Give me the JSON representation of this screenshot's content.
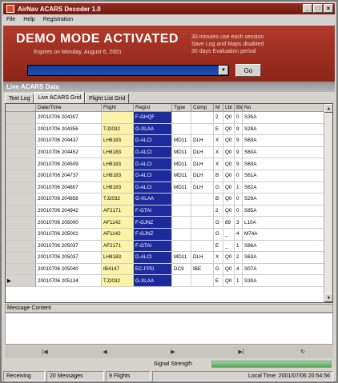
{
  "window": {
    "title": "AirNav ACARS Decoder 1.0",
    "buttons": [
      "_",
      "□",
      "×"
    ]
  },
  "menu": [
    "File",
    "Help",
    "Registration"
  ],
  "demo": {
    "title": "DEMO MODE ACTIVATED",
    "expires": "Expires on Monday, August 6, 2001",
    "notes": [
      "30 minutes use each session",
      "Save Log and Maps disabled",
      "30 days Evaluation period"
    ],
    "go_label": "Go"
  },
  "live": {
    "title": "Live ACARS Data",
    "tabs": [
      "Text Log",
      "Live ACARS Grid",
      "Flight List Grid"
    ],
    "active_tab": 1
  },
  "grid": {
    "columns": [
      "Date/Time",
      "Flight",
      "Regist",
      "Type",
      "Comp",
      "M",
      "Lbl",
      "Blc",
      "No"
    ],
    "rows": [
      [
        "20010706 204307",
        "",
        "F-GHQF",
        "",
        "",
        "2",
        "Q0",
        "0",
        "S35A"
      ],
      [
        "20010706 204356",
        "TJ2032",
        "G-XLAA",
        "",
        "",
        "E",
        "Q0",
        "9",
        "S28A"
      ],
      [
        "20010706 204437",
        "LH8183",
        "D-ALCI",
        "MD11",
        "DLH",
        "X",
        "Q0",
        "9",
        "S60A"
      ],
      [
        "20010706 204452",
        "LH8183",
        "D-ALCI",
        "MD11",
        "DLH",
        "X",
        "Q0",
        "9",
        "S60A"
      ],
      [
        "20010706 204509",
        "LH8183",
        "D-ALCI",
        "MD11",
        "DLH",
        "X",
        "Q0",
        "9",
        "S60A"
      ],
      [
        "20010706 204737",
        "LH8183",
        "D-ALCI",
        "MD11",
        "DLH",
        "B",
        "Q0",
        "0",
        "S61A"
      ],
      [
        "20010706 204807",
        "LH8183",
        "D-ALCI",
        "MD11",
        "DLH",
        "G",
        "Q0",
        "1",
        "S62A"
      ],
      [
        "20010706 204858",
        "TJ2032",
        "G-XLAA",
        "",
        "",
        "B",
        "Q0",
        "0",
        "S29A"
      ],
      [
        "20010706 204942",
        "AF2171",
        "F-GTAI",
        "",
        "",
        "2",
        "Q0",
        "0",
        "S85A"
      ],
      [
        "20010706 205000",
        "AF1142",
        "F-GJNZ",
        "",
        "",
        "G",
        "89",
        "3",
        "L10A"
      ],
      [
        "20010706 205001",
        "AF1142",
        "F-GJNZ",
        "",
        "",
        "G",
        "_",
        "4",
        "M74A"
      ],
      [
        "20010706 205037",
        "AF2171",
        "F-GTAI",
        "",
        "",
        "E",
        "_",
        "1",
        "S86A"
      ],
      [
        "20010706 205037",
        "LH8183",
        "D-ALCI",
        "MD11",
        "DLH",
        "X",
        "Q0",
        "2",
        "S63A"
      ],
      [
        "20010706 205040",
        "IB4147",
        "EC-FPD",
        "DC9",
        "IBE",
        "G",
        "Q0",
        "4",
        "S07A"
      ],
      [
        "20010706 205134",
        "TJ2032",
        "G-XLAA",
        "",
        "",
        "E",
        "Q0",
        "1",
        "S30A"
      ]
    ],
    "selected_row": 14
  },
  "message": {
    "title": "Message Content"
  },
  "nav": {
    "first": "|◀",
    "prev": "◀",
    "next": "▶",
    "last": "▶|",
    "refresh": "↻"
  },
  "signal": {
    "label": "Signal Strength",
    "level": 1.0
  },
  "status": {
    "state": "Receiving",
    "messages": "20 Messages",
    "flights": "9 Flights",
    "local_time": "Local Time: 2001/07/06 20:54:56"
  }
}
